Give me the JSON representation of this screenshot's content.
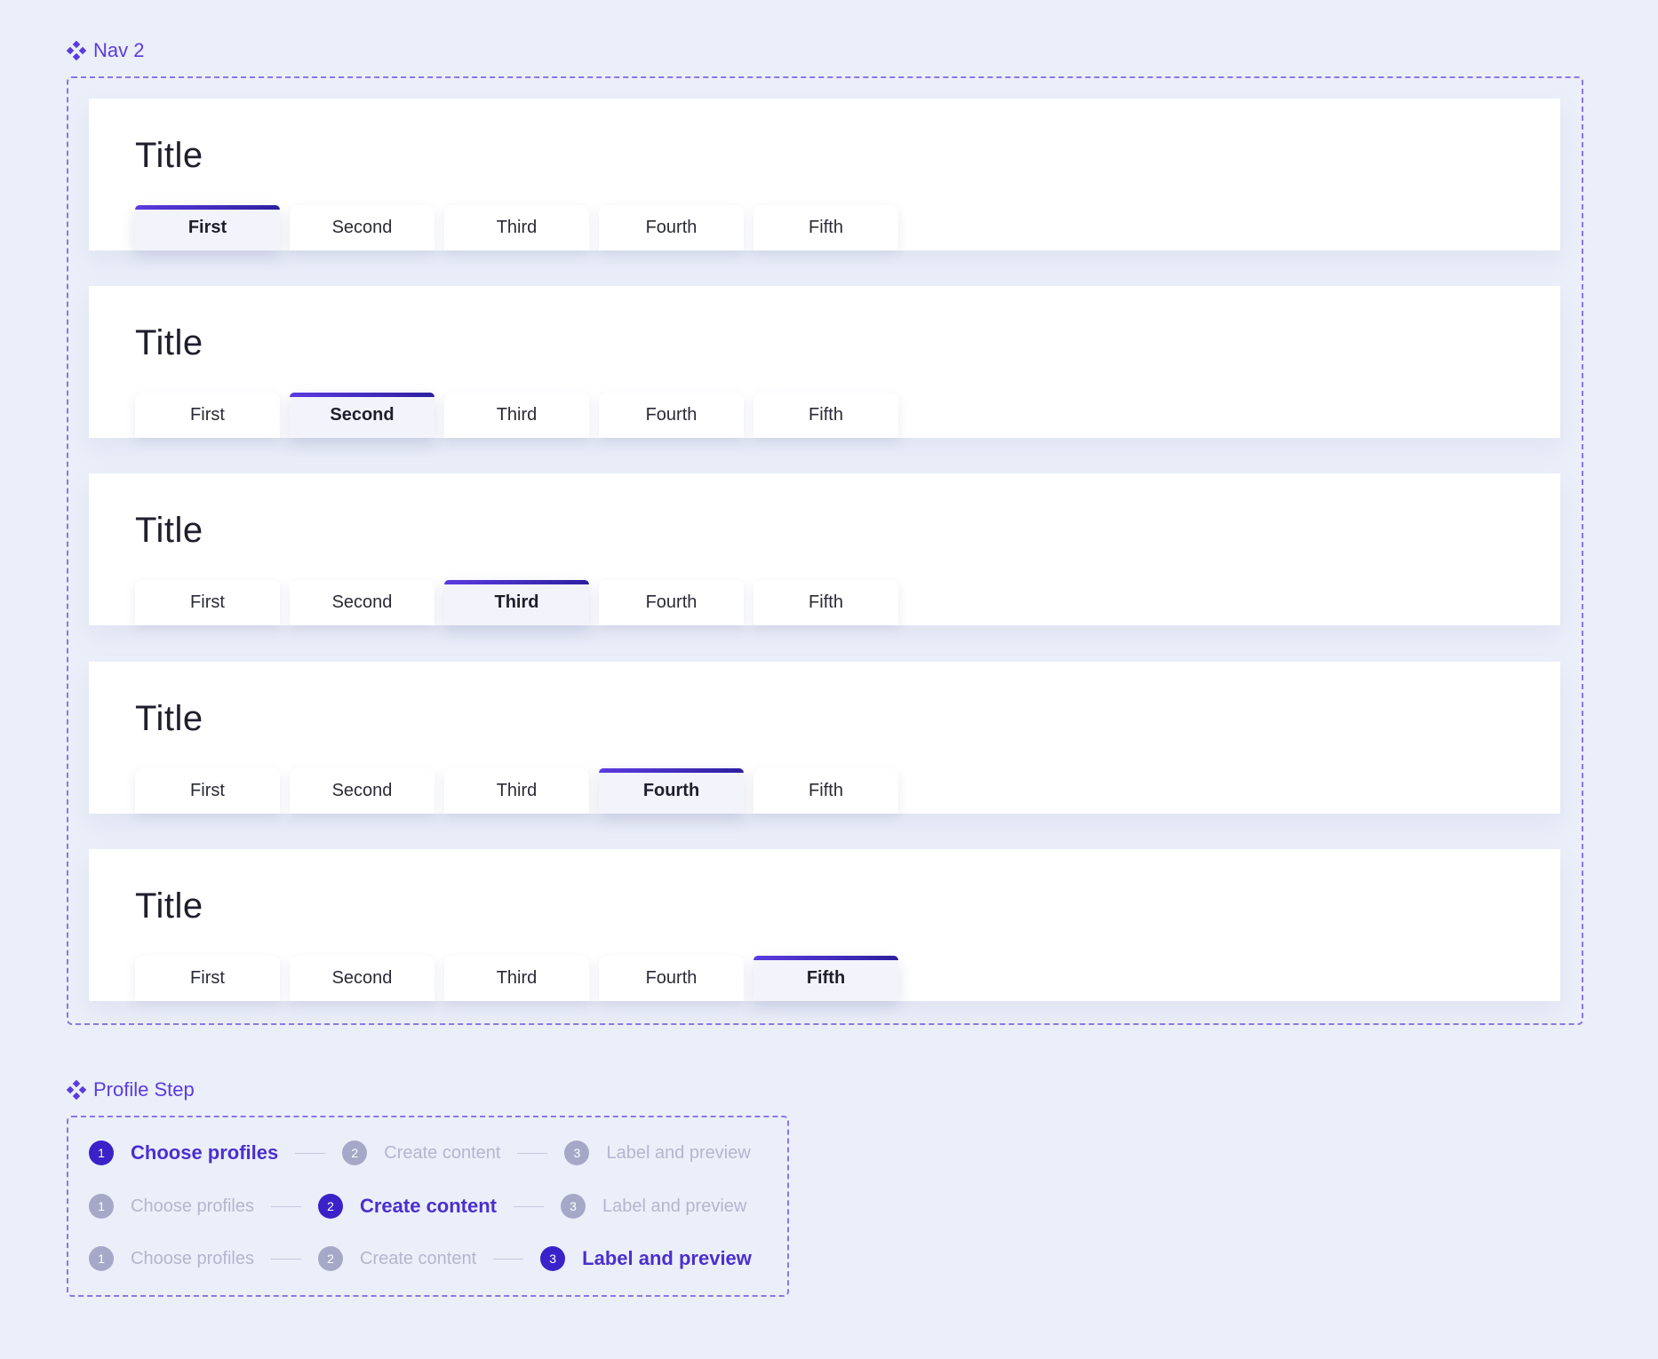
{
  "nav_section": {
    "label": "Nav 2",
    "cards": [
      {
        "title": "Title",
        "tabs": [
          "First",
          "Second",
          "Third",
          "Fourth",
          "Fifth"
        ],
        "active": 0
      },
      {
        "title": "Title",
        "tabs": [
          "First",
          "Second",
          "Third",
          "Fourth",
          "Fifth"
        ],
        "active": 1
      },
      {
        "title": "Title",
        "tabs": [
          "First",
          "Second",
          "Third",
          "Fourth",
          "Fifth"
        ],
        "active": 2
      },
      {
        "title": "Title",
        "tabs": [
          "First",
          "Second",
          "Third",
          "Fourth",
          "Fifth"
        ],
        "active": 3
      },
      {
        "title": "Title",
        "tabs": [
          "First",
          "Second",
          "Third",
          "Fourth",
          "Fifth"
        ],
        "active": 4
      }
    ]
  },
  "profile_section": {
    "label": "Profile Step",
    "rows": [
      {
        "active": 0,
        "steps": [
          {
            "num": "1",
            "label": "Choose profiles"
          },
          {
            "num": "2",
            "label": "Create content"
          },
          {
            "num": "3",
            "label": "Label and preview"
          }
        ]
      },
      {
        "active": 1,
        "steps": [
          {
            "num": "1",
            "label": "Choose profiles"
          },
          {
            "num": "2",
            "label": "Create content"
          },
          {
            "num": "3",
            "label": "Label and preview"
          }
        ]
      },
      {
        "active": 2,
        "steps": [
          {
            "num": "1",
            "label": "Choose profiles"
          },
          {
            "num": "2",
            "label": "Create content"
          },
          {
            "num": "3",
            "label": "Label and preview"
          }
        ]
      }
    ]
  },
  "colors": {
    "background": "#EBEFF9",
    "accent": "#5B3BE0",
    "accent_dark": "#3A22C9",
    "inactive_step": "#A6A8C8"
  },
  "icons": {
    "section_marker": "component-diamond-icon"
  }
}
